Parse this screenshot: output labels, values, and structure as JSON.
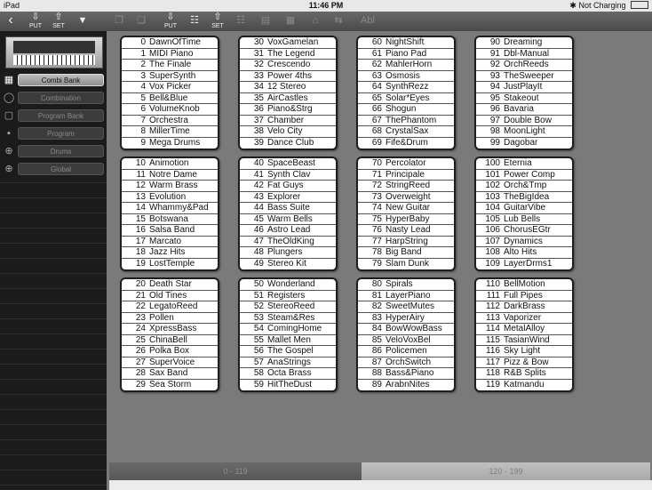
{
  "status": {
    "device": "iPad",
    "time": "11:46 PM",
    "charging": "Not Charging"
  },
  "toolbar": {
    "put": "PUT",
    "set": "SET",
    "abl": "Abl"
  },
  "sidebar": {
    "items": [
      "Combi Bank",
      "Combination",
      "Program Bank",
      "Program",
      "Drums",
      "Global"
    ],
    "active": "Combi Bank"
  },
  "groups": [
    [
      [
        0,
        "DawnOfTime"
      ],
      [
        1,
        "MIDI Piano"
      ],
      [
        2,
        "The Finale"
      ],
      [
        3,
        "SuperSynth"
      ],
      [
        4,
        "Vox Picker"
      ],
      [
        5,
        "Bell&Blue"
      ],
      [
        6,
        "VolumeKnob"
      ],
      [
        7,
        "Orchestra"
      ],
      [
        8,
        "MillerTime"
      ],
      [
        9,
        "Mega Drums"
      ]
    ],
    [
      [
        30,
        "VoxGamelan"
      ],
      [
        31,
        "The Legend"
      ],
      [
        32,
        "Crescendo"
      ],
      [
        33,
        "Power 4ths"
      ],
      [
        34,
        "12 Stereo"
      ],
      [
        35,
        "AirCastles"
      ],
      [
        36,
        "Piano&Strg"
      ],
      [
        37,
        "Chamber"
      ],
      [
        38,
        "Velo City"
      ],
      [
        39,
        "Dance Club"
      ]
    ],
    [
      [
        60,
        "NightShift"
      ],
      [
        61,
        "Piano Pad"
      ],
      [
        62,
        "MahlerHorn"
      ],
      [
        63,
        "Osmosis"
      ],
      [
        64,
        "SynthRezz"
      ],
      [
        65,
        "Solar*Eyes"
      ],
      [
        66,
        "Shogun"
      ],
      [
        67,
        "ThePhantom"
      ],
      [
        68,
        "CrystalSax"
      ],
      [
        69,
        "Fife&Drum"
      ]
    ],
    [
      [
        90,
        "Dreaming"
      ],
      [
        91,
        "Dbl-Manual"
      ],
      [
        92,
        "OrchReeds"
      ],
      [
        93,
        "TheSweeper"
      ],
      [
        94,
        "JustPlayIt"
      ],
      [
        95,
        "Stakeout"
      ],
      [
        96,
        "Bavaria"
      ],
      [
        97,
        "Double Bow"
      ],
      [
        98,
        "MoonLight"
      ],
      [
        99,
        "Dagobar"
      ]
    ],
    [
      [
        10,
        "Animotion"
      ],
      [
        11,
        "Notre Dame"
      ],
      [
        12,
        "Warm Brass"
      ],
      [
        13,
        "Evolution"
      ],
      [
        14,
        "Whammy&Pad"
      ],
      [
        15,
        "Botswana"
      ],
      [
        16,
        "Salsa Band"
      ],
      [
        17,
        "Marcato"
      ],
      [
        18,
        "Jazz Hits"
      ],
      [
        19,
        "LostTemple"
      ]
    ],
    [
      [
        40,
        "SpaceBeast"
      ],
      [
        41,
        "Synth Clav"
      ],
      [
        42,
        "Fat Guys"
      ],
      [
        43,
        "Explorer"
      ],
      [
        44,
        "Bass Suite"
      ],
      [
        45,
        "Warm Bells"
      ],
      [
        46,
        "Astro Lead"
      ],
      [
        47,
        "TheOldKing"
      ],
      [
        48,
        "Plungers"
      ],
      [
        49,
        "Stereo Kit"
      ]
    ],
    [
      [
        70,
        "Percolator"
      ],
      [
        71,
        "Principale"
      ],
      [
        72,
        "StringReed"
      ],
      [
        73,
        "Overweight"
      ],
      [
        74,
        "New Guitar"
      ],
      [
        75,
        "HyperBaby"
      ],
      [
        76,
        "Nasty Lead"
      ],
      [
        77,
        "HarpString"
      ],
      [
        78,
        "Big Band"
      ],
      [
        79,
        "Slam Dunk"
      ]
    ],
    [
      [
        100,
        "Eternia"
      ],
      [
        101,
        "Power Comp"
      ],
      [
        102,
        "Orch&Tmp"
      ],
      [
        103,
        "TheBigIdea"
      ],
      [
        104,
        "GuitarVibe"
      ],
      [
        105,
        "Lub Bells"
      ],
      [
        106,
        "ChorusEGtr"
      ],
      [
        107,
        "Dynamics"
      ],
      [
        108,
        "Alto Hits"
      ],
      [
        109,
        "LayerDrms1"
      ]
    ],
    [
      [
        20,
        "Death Star"
      ],
      [
        21,
        "Old Tines"
      ],
      [
        22,
        "LegatoReed"
      ],
      [
        23,
        "Pollen"
      ],
      [
        24,
        "XpressBass"
      ],
      [
        25,
        "ChinaBell"
      ],
      [
        26,
        "Polka Box"
      ],
      [
        27,
        "SuperVoice"
      ],
      [
        28,
        "Sax Band"
      ],
      [
        29,
        "Sea Storm"
      ]
    ],
    [
      [
        50,
        "Wonderland"
      ],
      [
        51,
        "Registers"
      ],
      [
        52,
        "StereoReed"
      ],
      [
        53,
        "Steam&Res"
      ],
      [
        54,
        "ComingHome"
      ],
      [
        55,
        "Mallet Men"
      ],
      [
        56,
        "The Gospel"
      ],
      [
        57,
        "AnaStrings"
      ],
      [
        58,
        "Octa Brass"
      ],
      [
        59,
        "HitTheDust"
      ]
    ],
    [
      [
        80,
        "Spirals"
      ],
      [
        81,
        "LayerPiano"
      ],
      [
        82,
        "SweetMutes"
      ],
      [
        83,
        "HyperAiry"
      ],
      [
        84,
        "BowWowBass"
      ],
      [
        85,
        "VeloVoxBel"
      ],
      [
        86,
        "Policemen"
      ],
      [
        87,
        "OrchSwitch"
      ],
      [
        88,
        "Bass&Piano"
      ],
      [
        89,
        "ArabnNites"
      ]
    ],
    [
      [
        110,
        "BellMotion"
      ],
      [
        111,
        "Full Pipes"
      ],
      [
        112,
        "DarkBrass"
      ],
      [
        113,
        "Vaporizer"
      ],
      [
        114,
        "MetalAlloy"
      ],
      [
        115,
        "TasianWind"
      ],
      [
        116,
        "Sky Light"
      ],
      [
        117,
        "Pizz & Bow"
      ],
      [
        118,
        "R&B Splits"
      ],
      [
        119,
        "Katmandu"
      ]
    ]
  ],
  "bank_tabs": [
    "0 - 119",
    "120 - 199"
  ]
}
